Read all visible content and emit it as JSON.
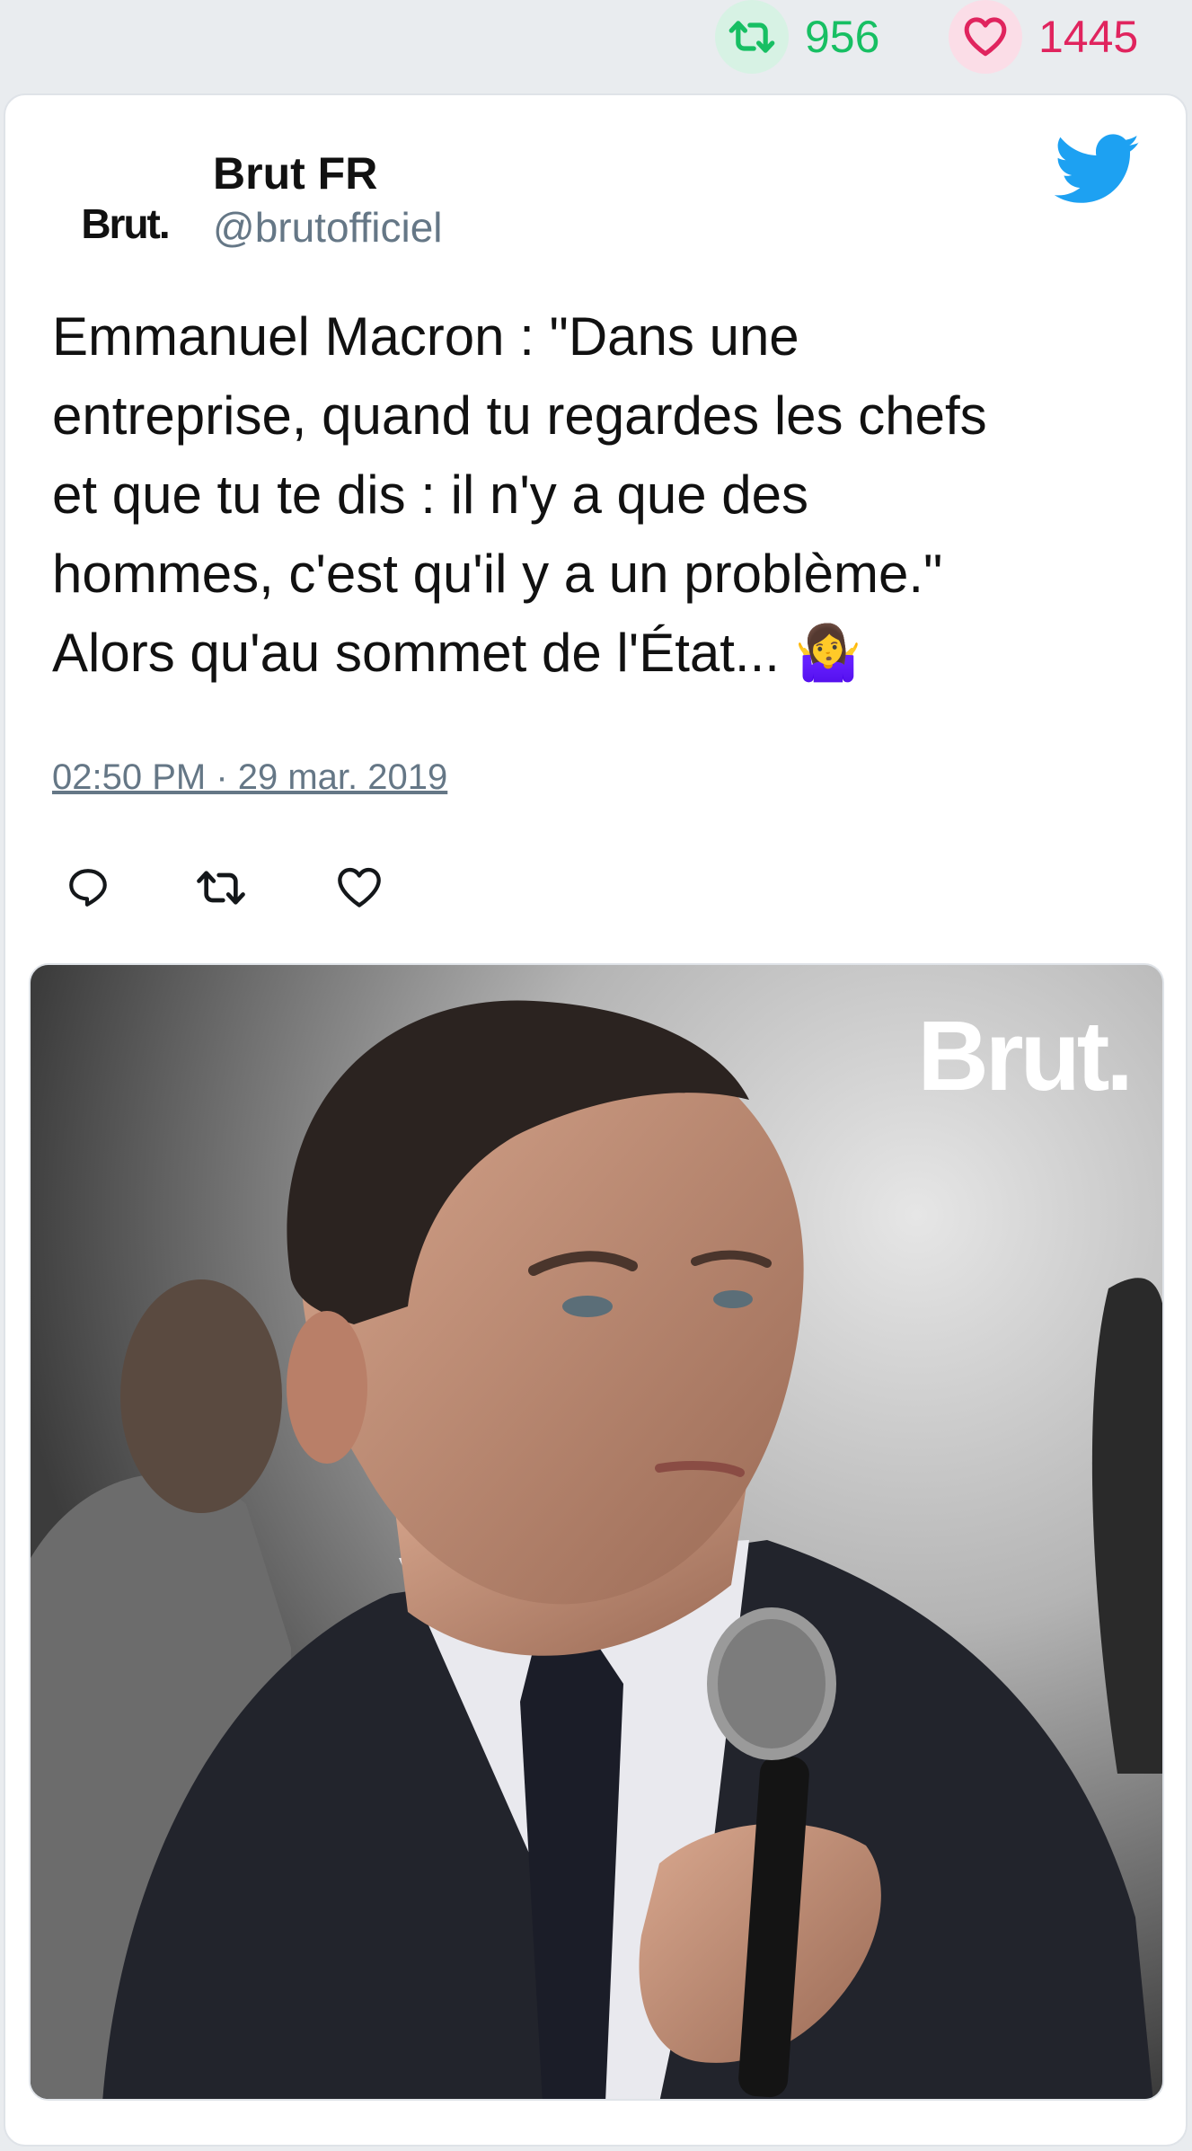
{
  "stats": {
    "retweets": "956",
    "likes": "1445",
    "retweet_icon": "retweet-icon",
    "like_icon": "heart-icon",
    "retweet_color": "#17bf63",
    "like_color": "#e0245e"
  },
  "tweet": {
    "display_name": "Brut FR",
    "handle": "@brutofficiel",
    "avatar_text": "Brut.",
    "text": "Emmanuel Macron : \"Dans une\nentreprise, quand tu regardes les chefs\net que tu te dis : il n'y a que des\nhommes, c'est qu'il y a un problème.\"\nAlors qu'au sommet de l'État... 🤷‍♀️",
    "timestamp": "02:50 PM · 29 mar. 2019",
    "platform_icon": "twitter-bird-icon",
    "brand_color": "#1da1f2"
  },
  "actions": {
    "reply_icon": "reply-icon",
    "retweet_icon": "retweet-icon",
    "like_icon": "heart-icon"
  },
  "media": {
    "watermark": "Brut.",
    "description_icon": "video-thumbnail"
  }
}
